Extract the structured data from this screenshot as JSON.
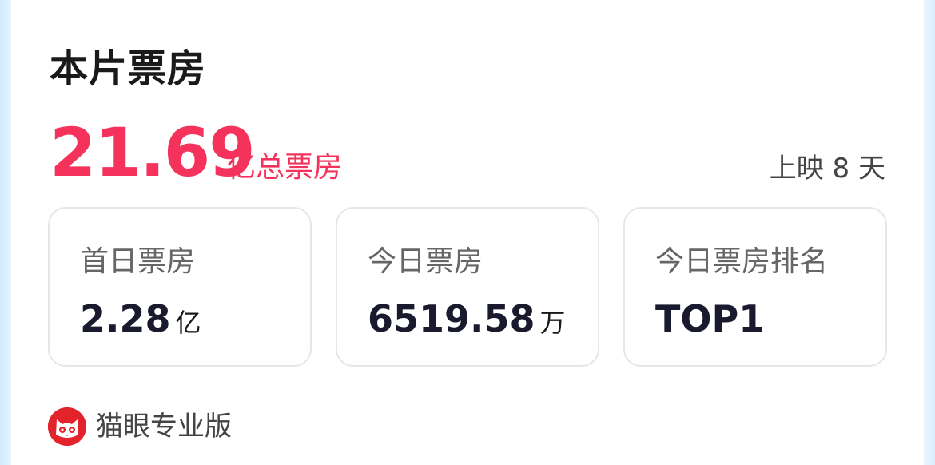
{
  "card": {
    "title": "本片票房",
    "total_value": "21.69",
    "total_unit": "亿总票房",
    "days_showing": "上映 8 天"
  },
  "stats": [
    {
      "label": "首日票房",
      "value": "2.28",
      "unit": "亿"
    },
    {
      "label": "今日票房",
      "value": "6519.58",
      "unit": "万"
    },
    {
      "label": "今日票房排名",
      "value": "TOP1",
      "unit": ""
    }
  ],
  "footer": {
    "brand": "猫眼专业版",
    "logo_icon": "maoyan-cat-logo-icon",
    "logo_color": "#e2232b"
  },
  "colors": {
    "accent": "#f5325c",
    "text_primary": "#1a1a1a",
    "text_secondary": "#666666",
    "border": "#e6e6e6"
  }
}
